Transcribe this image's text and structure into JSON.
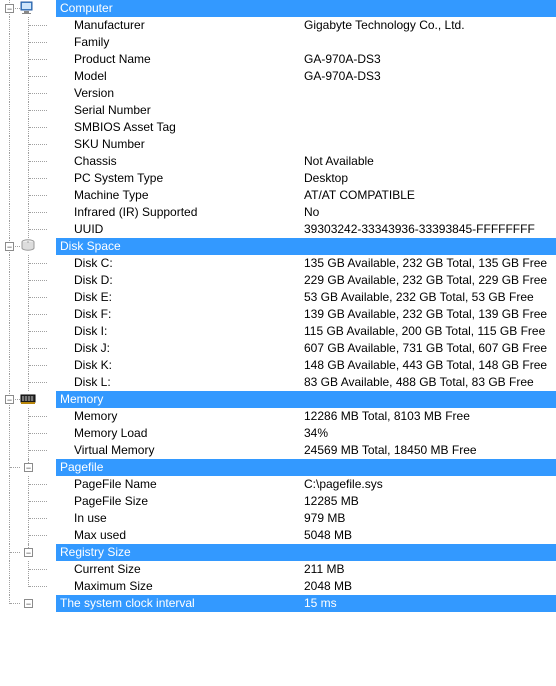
{
  "sections": {
    "computer": {
      "title": "Computer",
      "items": [
        {
          "label": "Manufacturer",
          "value": "Gigabyte Technology Co., Ltd."
        },
        {
          "label": "Family",
          "value": ""
        },
        {
          "label": "Product Name",
          "value": "GA-970A-DS3"
        },
        {
          "label": "Model",
          "value": "GA-970A-DS3"
        },
        {
          "label": "Version",
          "value": ""
        },
        {
          "label": "Serial Number",
          "value": ""
        },
        {
          "label": "SMBIOS Asset Tag",
          "value": ""
        },
        {
          "label": "SKU Number",
          "value": ""
        },
        {
          "label": "Chassis",
          "value": "Not Available"
        },
        {
          "label": "PC System Type",
          "value": "Desktop"
        },
        {
          "label": "Machine Type",
          "value": "AT/AT COMPATIBLE"
        },
        {
          "label": "Infrared (IR) Supported",
          "value": "No"
        },
        {
          "label": "UUID",
          "value": "39303242-33343936-33393845-FFFFFFFF"
        }
      ]
    },
    "disk": {
      "title": "Disk Space",
      "items": [
        {
          "label": "Disk C:",
          "value": "135 GB Available, 232 GB Total, 135 GB Free"
        },
        {
          "label": "Disk D:",
          "value": "229 GB Available, 232 GB Total, 229 GB Free"
        },
        {
          "label": "Disk E:",
          "value": "53 GB Available, 232 GB Total, 53 GB Free"
        },
        {
          "label": "Disk F:",
          "value": "139 GB Available, 232 GB Total, 139 GB Free"
        },
        {
          "label": "Disk I:",
          "value": "115 GB Available, 200 GB Total, 115 GB Free"
        },
        {
          "label": "Disk J:",
          "value": "607 GB Available, 731 GB Total, 607 GB Free"
        },
        {
          "label": "Disk K:",
          "value": "148 GB Available, 443 GB Total, 148 GB Free"
        },
        {
          "label": "Disk L:",
          "value": "83 GB Available, 488 GB Total, 83 GB Free"
        }
      ]
    },
    "memory": {
      "title": "Memory",
      "items": [
        {
          "label": "Memory",
          "value": "12286 MB Total, 8103 MB Free"
        },
        {
          "label": "Memory Load",
          "value": "34%"
        },
        {
          "label": "Virtual Memory",
          "value": "24569 MB Total, 18450 MB Free"
        }
      ]
    },
    "pagefile": {
      "title": "Pagefile",
      "items": [
        {
          "label": "PageFile Name",
          "value": "C:\\pagefile.sys"
        },
        {
          "label": "PageFile Size",
          "value": "12285 MB"
        },
        {
          "label": "In use",
          "value": "979 MB"
        },
        {
          "label": "Max used",
          "value": "5048 MB"
        }
      ]
    },
    "registry": {
      "title": "Registry Size",
      "items": [
        {
          "label": "Current Size",
          "value": "211 MB"
        },
        {
          "label": "Maximum Size",
          "value": "2048 MB"
        }
      ]
    },
    "clock": {
      "title": "The system clock interval",
      "value": "15 ms"
    }
  },
  "colors": {
    "highlight": "#3399ff"
  }
}
